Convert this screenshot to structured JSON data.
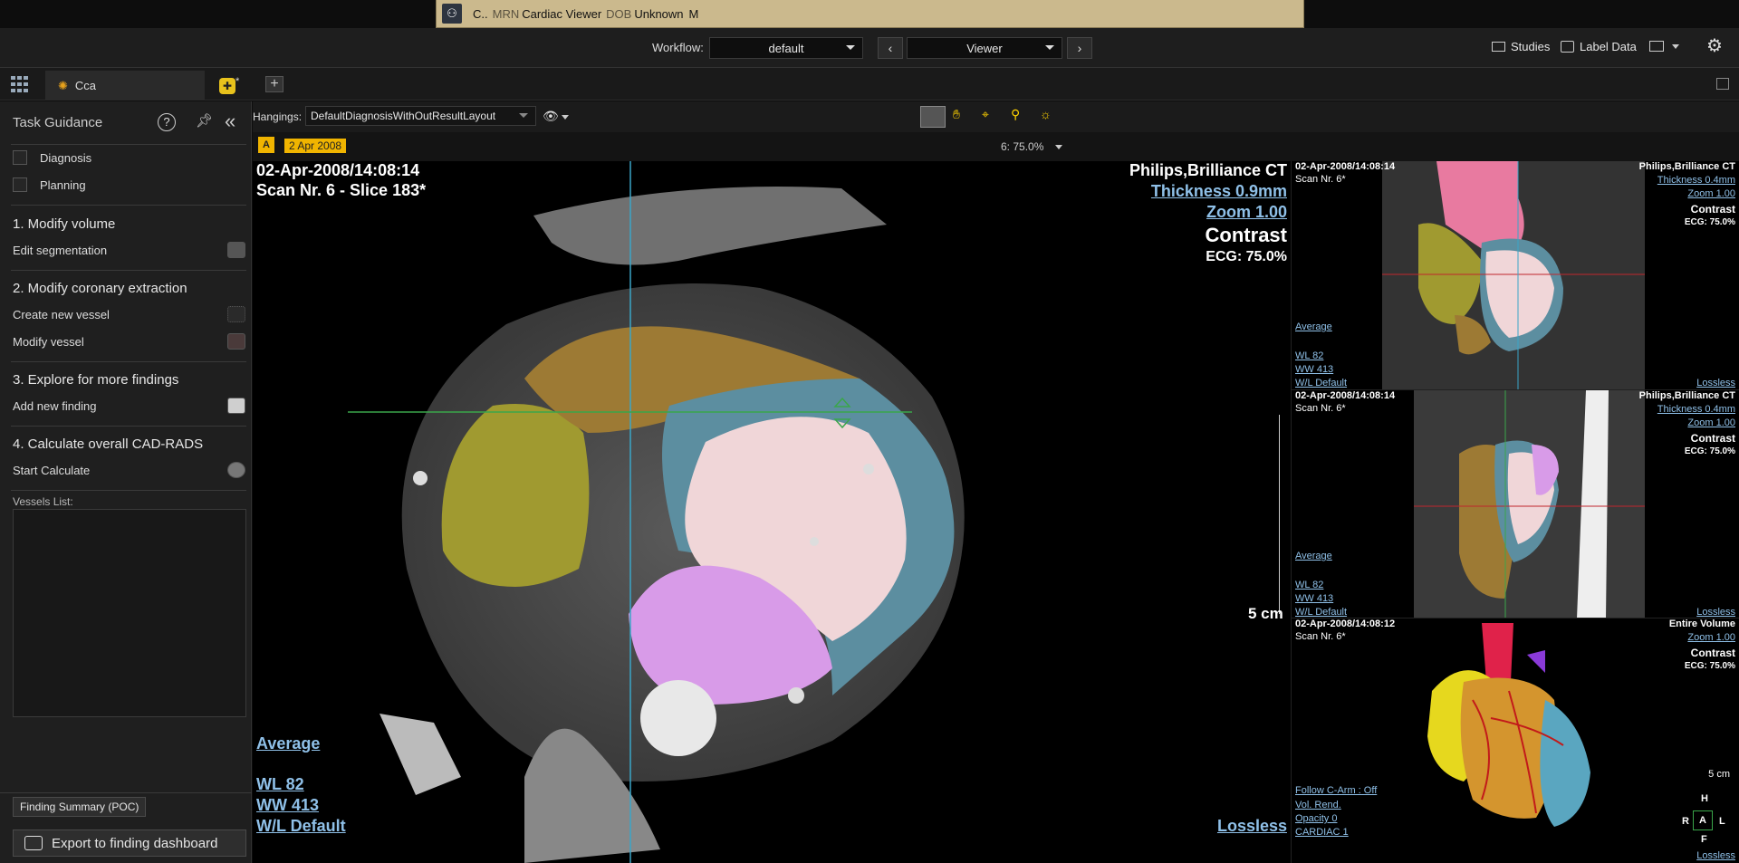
{
  "patient_banner": {
    "name": "C..",
    "mrn_label": "MRN",
    "mrn_value": "Cardiac Viewer",
    "dob_label": "DOB",
    "dob_value": "Unknown",
    "sex": "M"
  },
  "topbar": {
    "workflow_label": "Workflow:",
    "workflow_value": "default",
    "step_value": "Viewer",
    "studies_label": "Studies",
    "label_data_label": "Label Data"
  },
  "tabs": {
    "tab1_label": "Cca"
  },
  "task_guidance": {
    "title": "Task Guidance",
    "checks": [
      "Diagnosis",
      "Planning"
    ],
    "step1_title": "1.  Modify volume",
    "step1_item": "Edit segmentation",
    "step2_title": "2.  Modify coronary extraction",
    "step2_item1": "Create new vessel",
    "step2_item2": "Modify vessel",
    "step3_title": "3.  Explore for more findings",
    "step3_item": "Add new finding",
    "step4_title": "4.  Calculate overall CAD-RADS",
    "step4_item": "Start Calculate",
    "vessels_label": "Vessels List:",
    "finding_summary_button": "Finding Summary (POC)",
    "export_button": "Export to finding dashboard"
  },
  "viewer_toolbar": {
    "hangings_label": "Hangings:",
    "hangings_value": "DefaultDiagnosisWithOutResultLayout",
    "zoom_readout": "6: 75.0%"
  },
  "study_date_badge": "2 Apr 2008",
  "main_view": {
    "datetime": "02-Apr-2008/14:08:14",
    "scan": "Scan Nr. 6 - Slice 183*",
    "scanner": "Philips,Brilliance CT",
    "thickness": "Thickness 0.9mm",
    "zoom": "Zoom 1.00",
    "contrast": "Contrast",
    "ecg": "ECG: 75.0%",
    "scale": "5 cm",
    "average": "Average",
    "wl": "WL     82",
    "ww": "WW    413",
    "wl_default": "W/L Default",
    "lossless": "Lossless"
  },
  "view_top": {
    "datetime": "02-Apr-2008/14:08:14",
    "scan": "Scan Nr. 6*",
    "scanner": "Philips,Brilliance CT",
    "thickness": "Thickness 0.4mm",
    "zoom": "Zoom 1.00",
    "contrast": "Contrast",
    "ecg": "ECG: 75.0%",
    "average": "Average",
    "wl": "WL     82",
    "ww": "WW    413",
    "wl_default": "W/L Default",
    "lossless": "Lossless"
  },
  "view_mid": {
    "datetime": "02-Apr-2008/14:08:14",
    "scan": "Scan Nr. 6*",
    "scanner": "Philips,Brilliance CT",
    "thickness": "Thickness 0.4mm",
    "zoom": "Zoom 1.00",
    "contrast": "Contrast",
    "ecg": "ECG: 75.0%",
    "average": "Average",
    "wl": "WL     82",
    "ww": "WW    413",
    "wl_default": "W/L Default",
    "lossless": "Lossless"
  },
  "view_3d": {
    "datetime": "02-Apr-2008/14:08:12",
    "scan": "Scan Nr. 6*",
    "volume": "Entire Volume",
    "zoom": "Zoom 1.00",
    "contrast": "Contrast",
    "ecg": "ECG: 75.0%",
    "follow": "Follow C-Arm : Off",
    "vol_rend": "Vol. Rend.",
    "opacity": "Opacity  0",
    "preset": "CARDIAC 1",
    "scale": "5 cm",
    "orient_h": "H",
    "orient_r": "R",
    "orient_a": "A",
    "orient_l": "L",
    "orient_f": "F",
    "lossless": "Lossless"
  },
  "colors": {
    "banner": "#cbb98d",
    "link": "#8fc0e8",
    "badge": "#f0b400"
  }
}
